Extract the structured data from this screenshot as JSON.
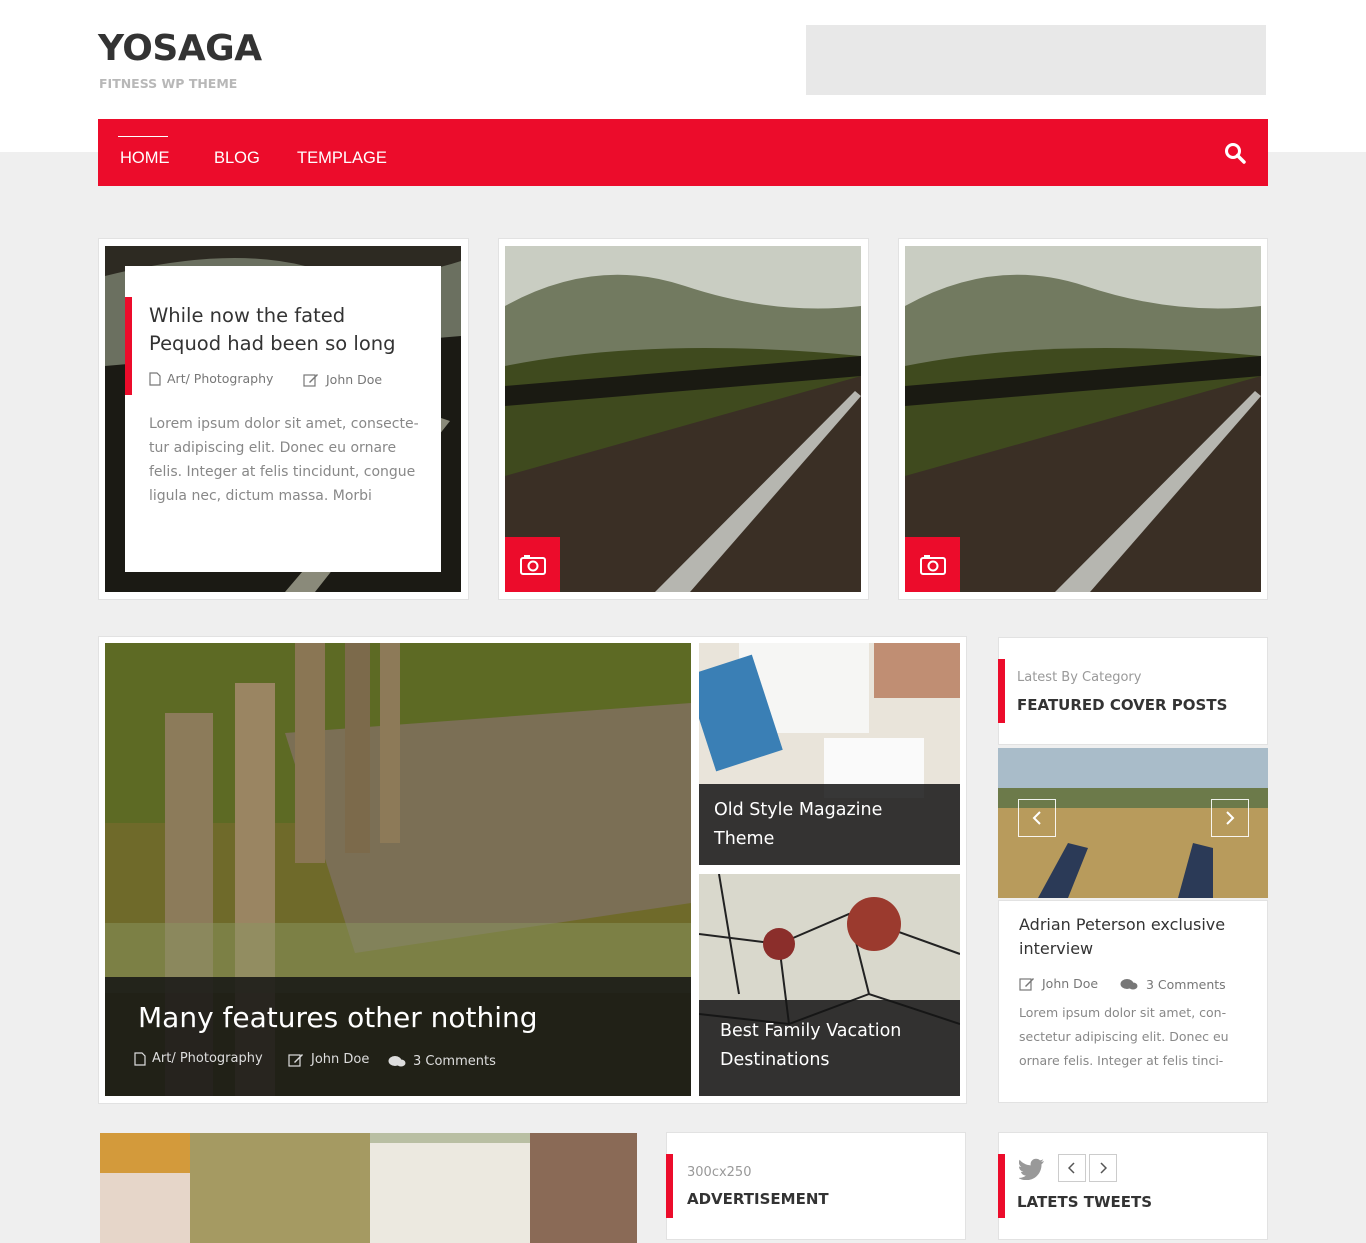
{
  "site": {
    "logo": "YOSAGA",
    "tagline": "FITNESS WP THEME"
  },
  "nav": {
    "items": [
      "HOME",
      "BLOG",
      "TEMPLAGE"
    ],
    "active": "HOME",
    "search_icon": "search-icon"
  },
  "featured_post": {
    "title_line1": "While now the fated",
    "title_line2": "Pequod had been so long",
    "category": "Art/ Photography",
    "author": "John Doe",
    "excerpt_lines": [
      "Lorem ipsum dolor sit amet, consecte-",
      "tur adipiscing elit. Donec eu ornare",
      "felis. Integer at felis tincidunt, congue",
      "ligula nec, dictum massa. Morbi"
    ]
  },
  "grid": {
    "main": {
      "title": "Many features other nothing",
      "category": "Art/ Photography",
      "author": "John Doe",
      "comments": "3 Comments"
    },
    "side1": {
      "title_line1": "Old Style Magazine",
      "title_line2": "Theme"
    },
    "side2": {
      "title_line1": "Best Family Vacation",
      "title_line2": "Destinations"
    }
  },
  "widget_featured": {
    "subtitle": "Latest By Category",
    "title": "FEATURED COVER POSTS",
    "post_title_line1": "Adrian Peterson exclusive",
    "post_title_line2": "interview",
    "author": "John Doe",
    "comments": "3 Comments",
    "excerpt_lines": [
      "Lorem ipsum dolor sit amet, con-",
      "sectetur adipiscing elit. Donec eu",
      "ornare felis. Integer at felis tinci-"
    ]
  },
  "widget_ad": {
    "subtitle": "300cx250",
    "title": "ADVERTISEMENT"
  },
  "widget_tweets": {
    "title": "LATETS TWEETS"
  },
  "colors": {
    "accent": "#ec0c2b",
    "background": "#efefef"
  }
}
